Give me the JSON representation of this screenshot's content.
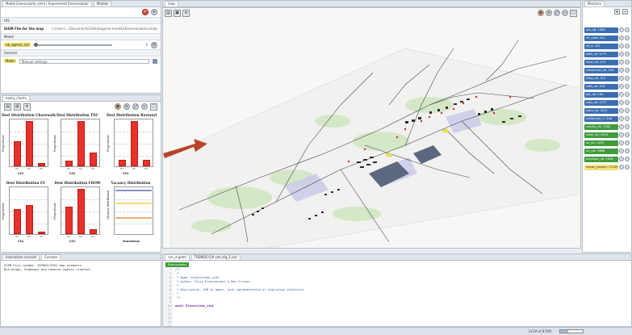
{
  "left_top": {
    "tabs": [
      "Model Eisenvolado_sim4 | Experiment Eisenvolador",
      "Models"
    ],
    "sections": {
      "gisfile_label": "GIS",
      "gisfile_row_label": "GISM File for the map",
      "gisfile_value": "c:\\Users\\...\\Documents\\GitHub\\gama-models\\Eisenvolado\\includes\\street.shp",
      "param_label": "Model",
      "param_row_label": "nb_agents_init",
      "param_value": "0",
      "general_label": "General",
      "general_row_label": "Mode",
      "general_value": "Manual settings"
    }
  },
  "left_mid": {
    "tabs": [
      "every_charts"
    ],
    "charts": [
      {
        "title": "Dest Distribution Chorewalk",
        "ylabel": "Proportions",
        "xlabel": "LYL",
        "categories": [
          "H1",
          "H2",
          "H3"
        ],
        "values": [
          55,
          100,
          8
        ]
      },
      {
        "title": "Dest Distribution TSU",
        "ylabel": "Proportions",
        "xlabel": "LYL",
        "categories": [
          "H1",
          "H2",
          "H3"
        ],
        "values": [
          12,
          100,
          30
        ]
      },
      {
        "title": "Dest Distribution Restaurl",
        "ylabel": "Proportions",
        "xlabel": "LYL",
        "categories": [
          "H1",
          "H2",
          "H3"
        ],
        "values": [
          15,
          100,
          15
        ]
      },
      {
        "title": "Dest Distribution EV",
        "ylabel": "Proportions",
        "xlabel": "LYL",
        "categories": [
          "H1",
          "H2",
          "H3"
        ],
        "values": [
          55,
          65,
          5
        ]
      },
      {
        "title": "Dest Distribution FBOW",
        "ylabel": "Proportions",
        "xlabel": "LYL",
        "categories": [
          "H1",
          "H2",
          "H3"
        ],
        "values": [
          60,
          100,
          10
        ]
      },
      {
        "title": "Vacancy Distribution",
        "ylabel": "Vacancy distribution",
        "xlabel": "Durations",
        "type": "line"
      }
    ]
  },
  "center_map": {
    "tabs": [
      "map"
    ]
  },
  "right": {
    "tabs": [
      "Monitors"
    ],
    "agents": [
      {
        "label": "aut_nb: 1560",
        "color": "blue"
      },
      {
        "label": "nb_road: 441",
        "color": "blue"
      },
      {
        "label": "nb_b: 151",
        "color": "blue"
      },
      {
        "label": "wait_nb: 1277",
        "color": "blue"
      },
      {
        "label": "exist_nb: 473",
        "color": "blue"
      },
      {
        "label": "restaurant_nb: 216",
        "color": "blue"
      },
      {
        "label": "shop_nb: 313",
        "color": "blue"
      },
      {
        "label": "cafe_nb: 216",
        "color": "blue"
      },
      {
        "label": "bar_nb: 181",
        "color": "blue"
      },
      {
        "label": "club_nb: 1277",
        "color": "blue"
      },
      {
        "label": "work_nb: 3411",
        "color": "blue"
      },
      {
        "label": "restaurant_1: 346",
        "color": "blue"
      },
      {
        "label": "charity_nb: 1900",
        "color": "green"
      },
      {
        "label": "room_nb: 2616",
        "color": "green"
      },
      {
        "label": "ev_nb: 1400",
        "color": "green"
      },
      {
        "label": "nb_car: 3668",
        "color": "green"
      },
      {
        "label": "overload_nb: 1618",
        "color": "green"
      },
      {
        "label": "shown_people: 17189",
        "color": "yellow"
      }
    ]
  },
  "bottom_left": {
    "tabs": [
      "Interactive console",
      "Console"
    ],
    "lines": [
      "GISM File loaded. 787002/2951 map_elements",
      "Buildings, Highways and Cameras agents created!"
    ]
  },
  "bottom_right": {
    "tabs": [
      "run_it.gaml",
      "TRENDS GVI sim.cfg_2.csv"
    ],
    "header_label": "Eisenvolador",
    "code_lines": [
      "/**",
      " *",
      " * Name: Eisenvolado_sim4",
      " * Author: Filip Eisenvolador & Max Fricker",
      " *",
      " * Description: GSM to Agent, with implementation of simulation statistics",
      " *",
      " */",
      "",
      "model Eisenvolado_sim4",
      "",
      "",
      "",
      "",
      "",
      ""
    ]
  },
  "statusbar": {
    "memory": "311M of 874M"
  }
}
